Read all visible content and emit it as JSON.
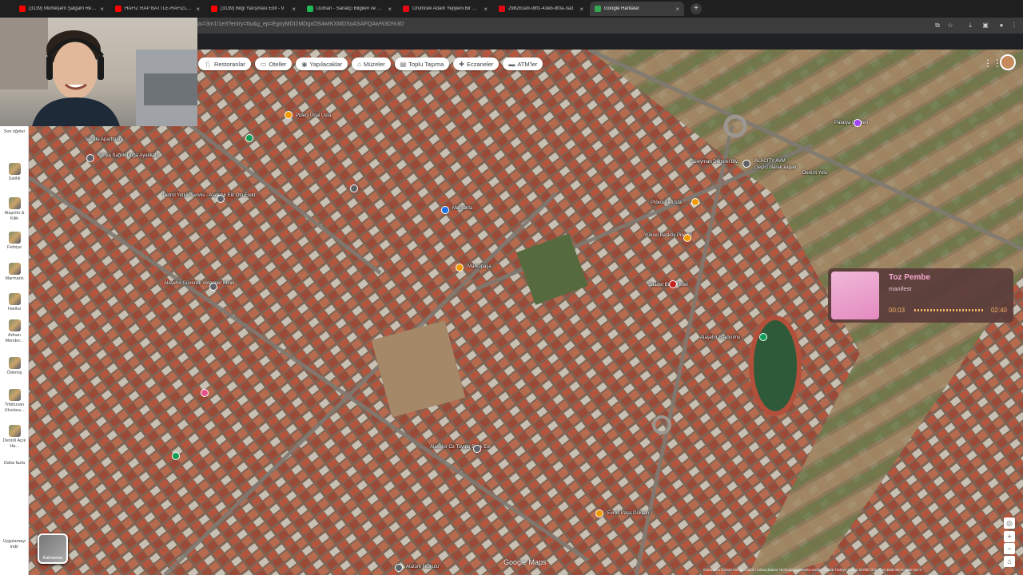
{
  "browser": {
    "tabs": [
      {
        "title": "(3139) Muhteşem Şalgam Reklam",
        "fav_color": "#ff0000"
      },
      {
        "title": "HAFIZ RAP BATTLE-HAFIZLAR",
        "fav_color": "#ff0000"
      },
      {
        "title": "(3139) Bilgi Yarışması Edit - 9",
        "fav_color": "#ff0000"
      },
      {
        "title": "Duman - Sanatçı Bilgileri ve Eser",
        "fav_color": "#1db954"
      },
      {
        "title": "Örümcek Adam Yepyeni Bir Gün",
        "fav_color": "#e50914"
      },
      {
        "title": "2982b1eb-08f1-43eb-8f0a-3a3",
        "fav_color": "#e50914"
      },
      {
        "title": "Google Haritalar",
        "fav_color": "#34a853"
      }
    ],
    "new_tab": "+",
    "url": "ta=!3m1!1e3?entry=ttu&g_ep=EgoyMDI2MDgxOS4wIKXMDSoASAFQAw%3D%3D"
  },
  "sidebar": {
    "items": [
      {
        "label": "Son öğeler"
      },
      {
        "label": "Salihli"
      },
      {
        "label": "Alaşehir & Kilik"
      },
      {
        "label": "Fethiye"
      },
      {
        "label": "Marmaris"
      },
      {
        "label": "Harika"
      },
      {
        "label": "Adnan Mender..."
      },
      {
        "label": "Ödemiş"
      },
      {
        "label": "Tribhuvan Uluslara..."
      },
      {
        "label": "Denizli Açık Ha..."
      },
      {
        "label": "Daha fazla"
      },
      {
        "label": "Uygulamayı indir"
      }
    ]
  },
  "chips": [
    {
      "label": "Restoranlar",
      "icon": "fork-knife-icon"
    },
    {
      "label": "Oteller",
      "icon": "bed-icon"
    },
    {
      "label": "Yapılacaklar",
      "icon": "camera-icon"
    },
    {
      "label": "Müzeler",
      "icon": "museum-icon"
    },
    {
      "label": "Toplu Taşıma",
      "icon": "bus-icon"
    },
    {
      "label": "Eczaneler",
      "icon": "pharmacy-icon"
    },
    {
      "label": "ATM'ler",
      "icon": "atm-icon"
    }
  ],
  "map_labels": [
    {
      "text": "Sahide Apartmanı"
    },
    {
      "text": "Kimya Sağlık Doğa Ayakkabı"
    },
    {
      "text": "Pideci Ünal Usta"
    },
    {
      "text": "Petrol Yetkili Servisi - Alaşehir Elit Oto Elekt"
    },
    {
      "text": "Margarita"
    },
    {
      "text": "Markopaşa"
    },
    {
      "text": "Alaşehir Güvenlik Veteriner Klinik"
    },
    {
      "text": "Pideci Ak Usta"
    },
    {
      "text": "ALACITY AVM"
    },
    {
      "text": "Geçici olarak kapalı"
    },
    {
      "text": "Patatya Garden"
    },
    {
      "text": "Yüksel Başköy Piliçleri"
    },
    {
      "text": "Saadet Bütik Hotel"
    },
    {
      "text": "Alaşehir Stadyumu"
    },
    {
      "text": "Alaşehir Oz Toygar Balık Evi"
    },
    {
      "text": "Atatürk İlkokulu"
    },
    {
      "text": "Evreli Paşa Dükkan"
    },
    {
      "text": "Denizli Yolu"
    },
    {
      "text": "Süleyman Demirel Blv."
    }
  ],
  "music_widget": {
    "song": "Toz Pembe",
    "artist": "manifest",
    "time_current": "00:03",
    "time_total": "02:40",
    "progress": 0.02
  },
  "map_controls": {
    "layers_label": "Katmanlar",
    "google_logo": "Google Maps",
    "footer": "Görüntüler ©2026 Airbus,CNES / Airbus,Maxar Technologies,Harita verileri ©2026   Türkiye   Şartlar   Gizlilik   Ürün Geri Bildirimi Gönder   50 m"
  }
}
